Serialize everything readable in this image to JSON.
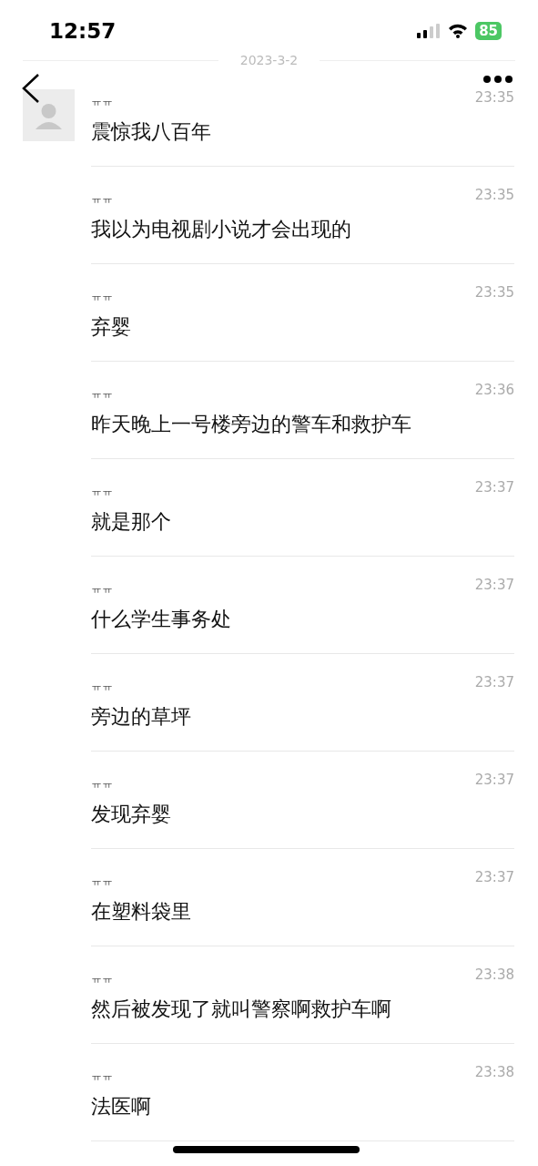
{
  "status_bar": {
    "time": "12:57",
    "battery": "85"
  },
  "date_divider": "2023-3-2",
  "messages": [
    {
      "sender": "ㅠㅠ",
      "time": "23:35",
      "text": "震惊我八百年",
      "show_avatar": true
    },
    {
      "sender": "ㅠㅠ",
      "time": "23:35",
      "text": "我以为电视剧小说才会出现的",
      "show_avatar": false
    },
    {
      "sender": "ㅠㅠ",
      "time": "23:35",
      "text": "弃婴",
      "show_avatar": false
    },
    {
      "sender": "ㅠㅠ",
      "time": "23:36",
      "text": "昨天晚上一号楼旁边的警车和救护车",
      "show_avatar": false
    },
    {
      "sender": "ㅠㅠ",
      "time": "23:37",
      "text": "就是那个",
      "show_avatar": false
    },
    {
      "sender": "ㅠㅠ",
      "time": "23:37",
      "text": "什么学生事务处",
      "show_avatar": false
    },
    {
      "sender": "ㅠㅠ",
      "time": "23:37",
      "text": "旁边的草坪",
      "show_avatar": false
    },
    {
      "sender": "ㅠㅠ",
      "time": "23:37",
      "text": "发现弃婴",
      "show_avatar": false
    },
    {
      "sender": "ㅠㅠ",
      "time": "23:37",
      "text": "在塑料袋里",
      "show_avatar": false
    },
    {
      "sender": "ㅠㅠ",
      "time": "23:38",
      "text": "然后被发现了就叫警察啊救护车啊",
      "show_avatar": false
    },
    {
      "sender": "ㅠㅠ",
      "time": "23:38",
      "text": "法医啊",
      "show_avatar": false
    }
  ]
}
